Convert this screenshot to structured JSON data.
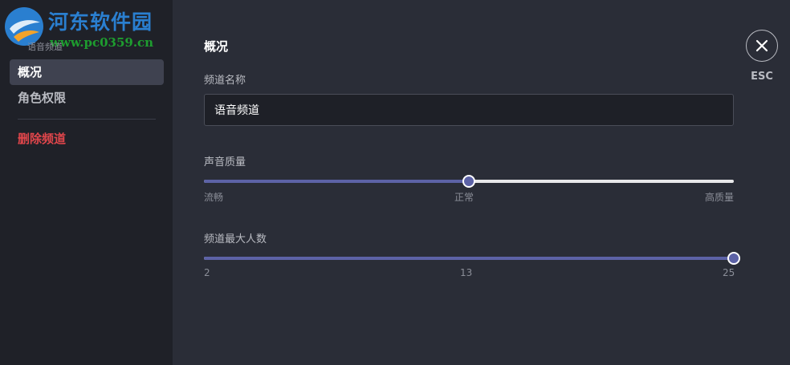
{
  "watermark": {
    "title": "河东软件园",
    "url": "www.pc0359.cn"
  },
  "sidebar": {
    "section_header": "语音频道",
    "items": [
      {
        "label": "概况"
      },
      {
        "label": "角色权限"
      },
      {
        "label": "删除频道"
      }
    ]
  },
  "main": {
    "title": "概况",
    "channel_name": {
      "label": "频道名称",
      "value": "语音频道"
    },
    "audio_quality": {
      "label": "声音质量",
      "value_fraction": 0.5,
      "ticks": [
        "流畅",
        "正常",
        "高质量"
      ]
    },
    "max_users": {
      "label": "频道最大人数",
      "min": 2,
      "max": 25,
      "value": 25,
      "ticks": [
        "2",
        "13",
        "25"
      ]
    }
  },
  "close": {
    "esc_label": "ESC"
  },
  "colors": {
    "accent": "#5c62a6",
    "danger": "#e0464b",
    "sidebar_bg": "#1f2128",
    "main_bg": "#2a2d37"
  }
}
